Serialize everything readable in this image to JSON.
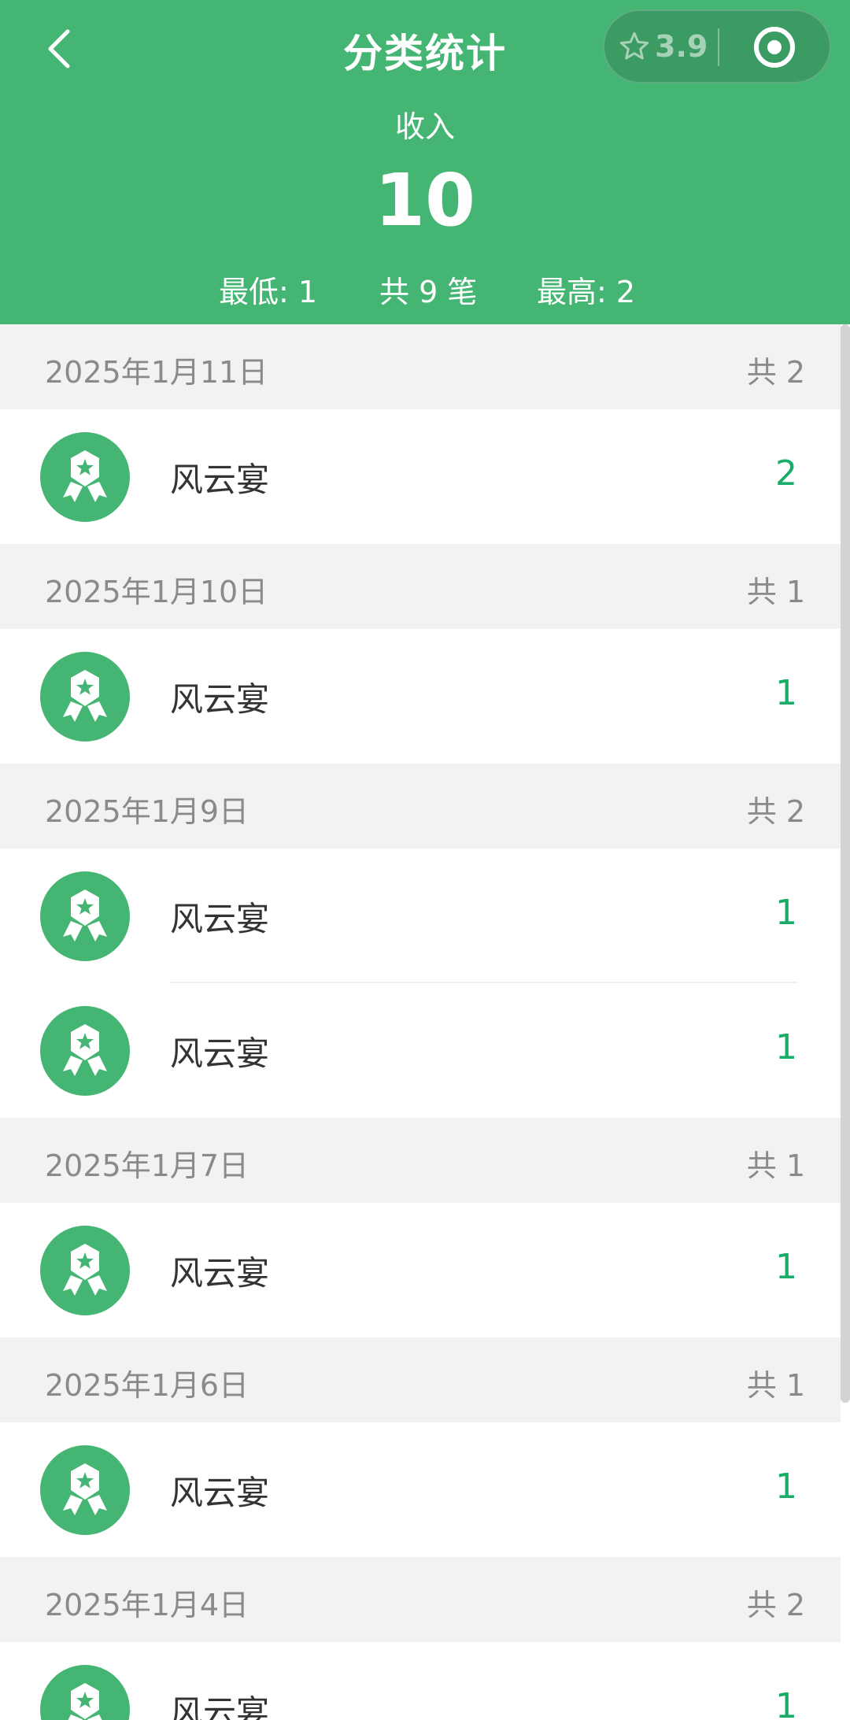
{
  "header": {
    "title": "分类统计",
    "rating": "3.9",
    "income_label": "收入",
    "total": "10",
    "min_label": "最低: 1",
    "count_label": "共 9 笔",
    "max_label": "最高: 2",
    "bg_color": "#45b574"
  },
  "groups": [
    {
      "date": "2025年1月11日",
      "sum": "共 2",
      "items": [
        {
          "name": "风云宴",
          "amount": "2"
        }
      ]
    },
    {
      "date": "2025年1月10日",
      "sum": "共 1",
      "items": [
        {
          "name": "风云宴",
          "amount": "1"
        }
      ]
    },
    {
      "date": "2025年1月9日",
      "sum": "共 2",
      "items": [
        {
          "name": "风云宴",
          "amount": "1"
        },
        {
          "name": "风云宴",
          "amount": "1"
        }
      ]
    },
    {
      "date": "2025年1月7日",
      "sum": "共 1",
      "items": [
        {
          "name": "风云宴",
          "amount": "1"
        }
      ]
    },
    {
      "date": "2025年1月6日",
      "sum": "共 1",
      "items": [
        {
          "name": "风云宴",
          "amount": "1"
        }
      ]
    },
    {
      "date": "2025年1月4日",
      "sum": "共 2",
      "items": [
        {
          "name": "风云宴",
          "amount": "1"
        }
      ]
    }
  ],
  "icons": {
    "back": "chevron-left-icon",
    "star": "star-outline-icon",
    "target": "target-icon",
    "category": "award-ribbon-icon"
  },
  "colors": {
    "accent": "#45b574",
    "amount": "#1aad6a"
  }
}
